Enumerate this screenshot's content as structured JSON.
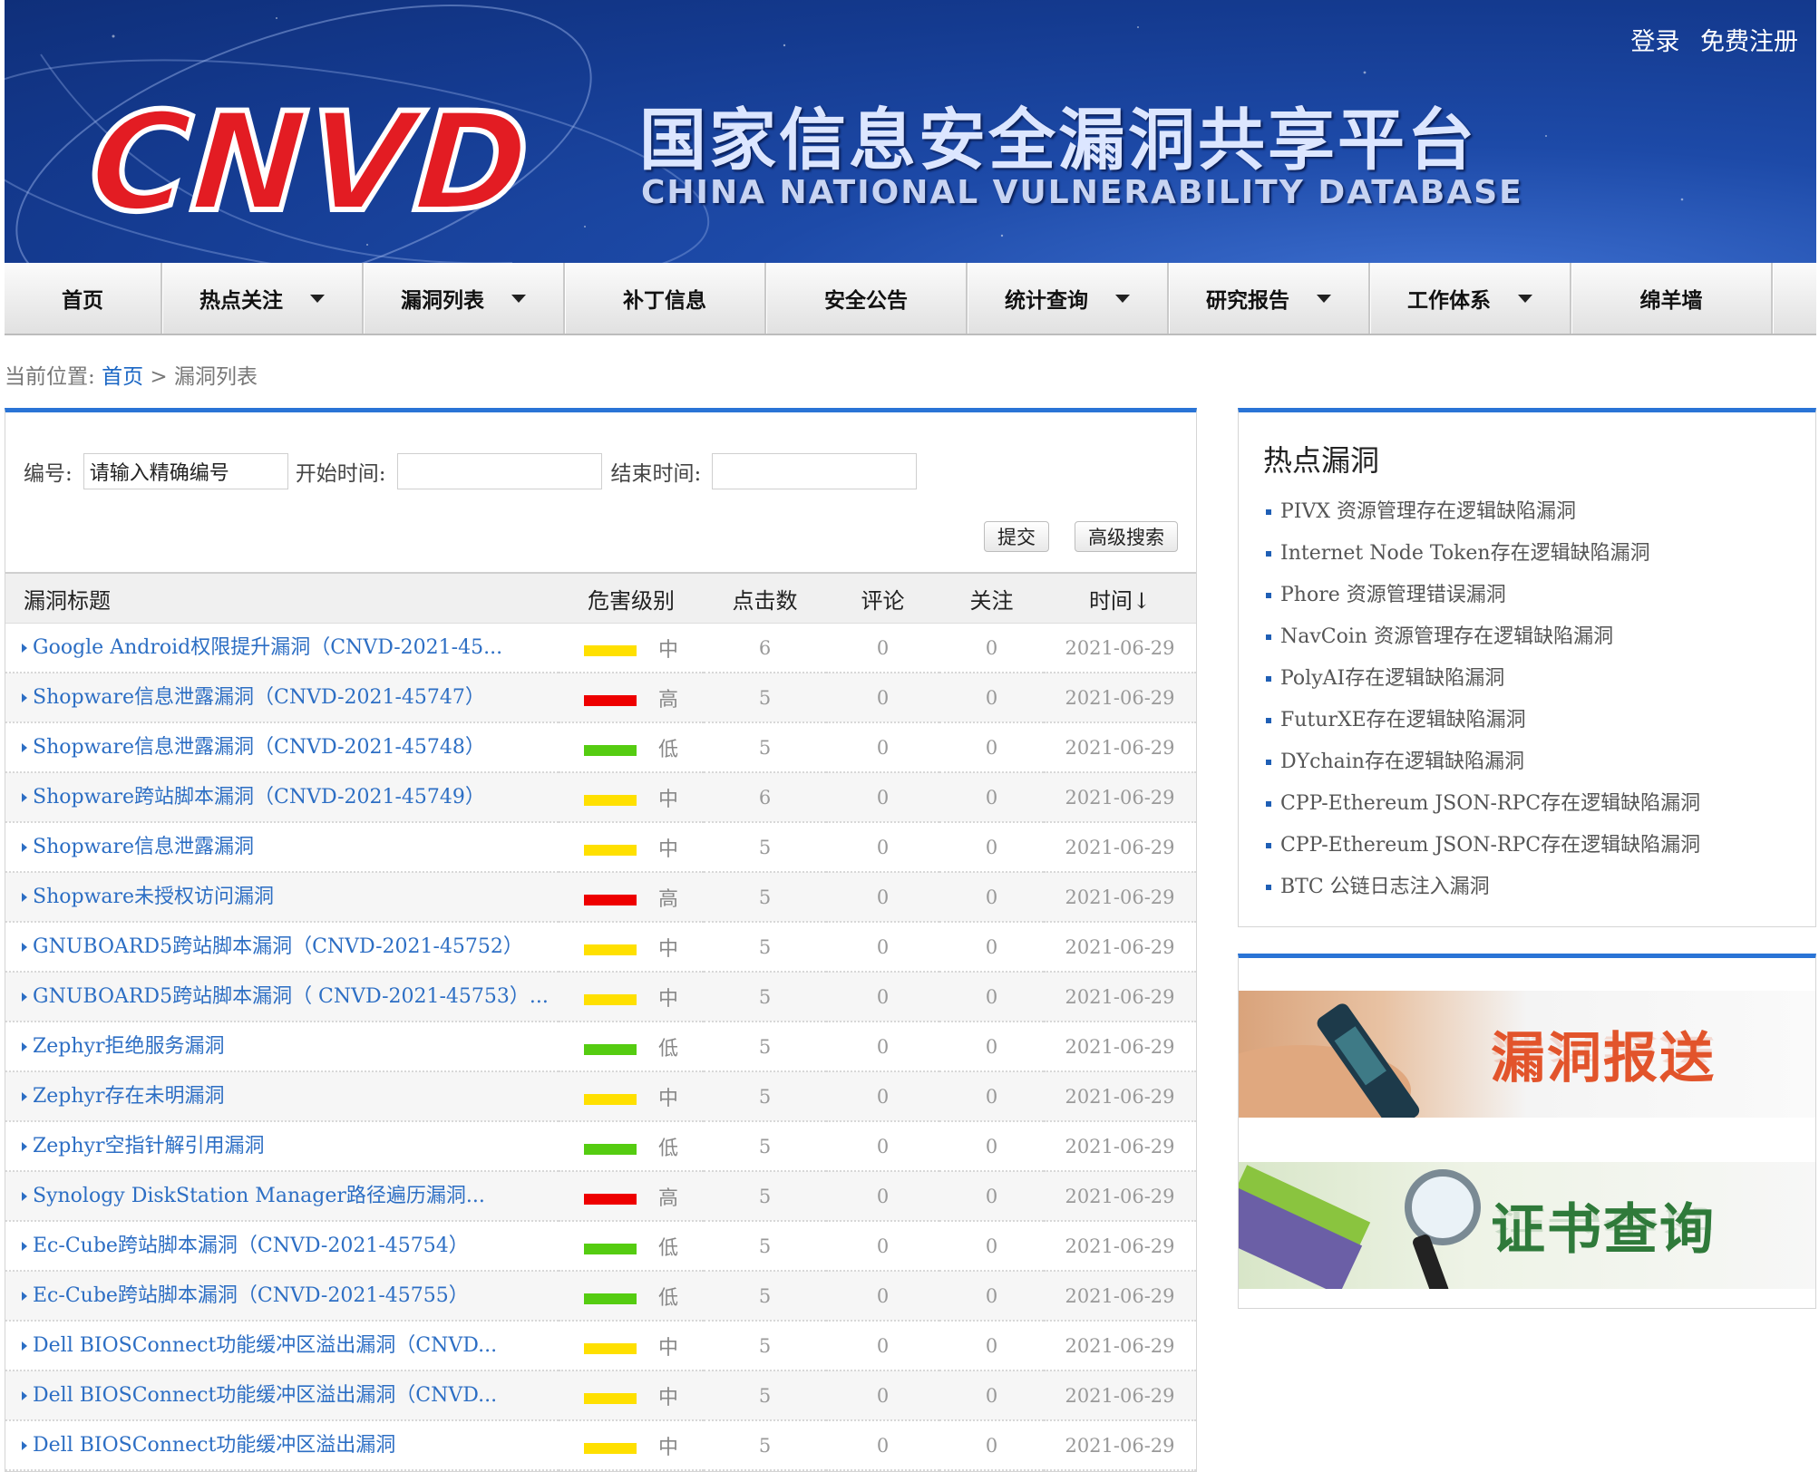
{
  "header": {
    "logo_text": "CNVD",
    "title": "国家信息安全漏洞共享平台",
    "subtitle": "CHINA NATIONAL VULNERABILITY DATABASE",
    "login": "登录",
    "register": "免费注册"
  },
  "nav": [
    {
      "label": "首页",
      "dropdown": false
    },
    {
      "label": "热点关注",
      "dropdown": true
    },
    {
      "label": "漏洞列表",
      "dropdown": true
    },
    {
      "label": "补丁信息",
      "dropdown": false
    },
    {
      "label": "安全公告",
      "dropdown": false
    },
    {
      "label": "统计查询",
      "dropdown": true
    },
    {
      "label": "研究报告",
      "dropdown": true
    },
    {
      "label": "工作体系",
      "dropdown": true
    },
    {
      "label": "绵羊墙",
      "dropdown": false
    }
  ],
  "breadcrumb": {
    "prefix": "当前位置:",
    "home": "首页",
    "sep": ">",
    "current": "漏洞列表"
  },
  "search": {
    "id_label": "编号:",
    "id_value": "请输入精确编号",
    "start_label": "开始时间:",
    "end_label": "结束时间:",
    "submit": "提交",
    "advanced": "高级搜索"
  },
  "colors": {
    "high": "#ee0000",
    "medium": "#ffe000",
    "low": "#55cc11",
    "accent": "#2a74d6",
    "link": "#2c6ec4"
  },
  "table": {
    "headers": {
      "title": "漏洞标题",
      "severity": "危害级别",
      "clicks": "点击数",
      "comments": "评论",
      "follows": "关注",
      "time": "时间↓"
    },
    "rows": [
      {
        "title": "Google Android权限提升漏洞（CNVD-2021-45...",
        "level": "medium",
        "severity": "中",
        "clicks": "6",
        "comments": "0",
        "follows": "0",
        "time": "2021-06-29"
      },
      {
        "title": "Shopware信息泄露漏洞（CNVD-2021-45747）",
        "level": "high",
        "severity": "高",
        "clicks": "5",
        "comments": "0",
        "follows": "0",
        "time": "2021-06-29"
      },
      {
        "title": "Shopware信息泄露漏洞（CNVD-2021-45748）",
        "level": "low",
        "severity": "低",
        "clicks": "5",
        "comments": "0",
        "follows": "0",
        "time": "2021-06-29"
      },
      {
        "title": "Shopware跨站脚本漏洞（CNVD-2021-45749）",
        "level": "medium",
        "severity": "中",
        "clicks": "6",
        "comments": "0",
        "follows": "0",
        "time": "2021-06-29"
      },
      {
        "title": "Shopware信息泄露漏洞",
        "level": "medium",
        "severity": "中",
        "clicks": "5",
        "comments": "0",
        "follows": "0",
        "time": "2021-06-29"
      },
      {
        "title": "Shopware未授权访问漏洞",
        "level": "high",
        "severity": "高",
        "clicks": "5",
        "comments": "0",
        "follows": "0",
        "time": "2021-06-29"
      },
      {
        "title": "GNUBOARD5跨站脚本漏洞（CNVD-2021-45752）",
        "level": "medium",
        "severity": "中",
        "clicks": "5",
        "comments": "0",
        "follows": "0",
        "time": "2021-06-29"
      },
      {
        "title": "GNUBOARD5跨站脚本漏洞（ CNVD-2021-45753）...",
        "level": "medium",
        "severity": "中",
        "clicks": "5",
        "comments": "0",
        "follows": "0",
        "time": "2021-06-29"
      },
      {
        "title": "Zephyr拒绝服务漏洞",
        "level": "low",
        "severity": "低",
        "clicks": "5",
        "comments": "0",
        "follows": "0",
        "time": "2021-06-29"
      },
      {
        "title": "Zephyr存在未明漏洞",
        "level": "medium",
        "severity": "中",
        "clicks": "5",
        "comments": "0",
        "follows": "0",
        "time": "2021-06-29"
      },
      {
        "title": "Zephyr空指针解引用漏洞",
        "level": "low",
        "severity": "低",
        "clicks": "5",
        "comments": "0",
        "follows": "0",
        "time": "2021-06-29"
      },
      {
        "title": "Synology DiskStation Manager路径遍历漏洞...",
        "level": "high",
        "severity": "高",
        "clicks": "5",
        "comments": "0",
        "follows": "0",
        "time": "2021-06-29"
      },
      {
        "title": "Ec-Cube跨站脚本漏洞（CNVD-2021-45754）",
        "level": "low",
        "severity": "低",
        "clicks": "5",
        "comments": "0",
        "follows": "0",
        "time": "2021-06-29"
      },
      {
        "title": "Ec-Cube跨站脚本漏洞（CNVD-2021-45755）",
        "level": "low",
        "severity": "低",
        "clicks": "5",
        "comments": "0",
        "follows": "0",
        "time": "2021-06-29"
      },
      {
        "title": "Dell BIOSConnect功能缓冲区溢出漏洞（CNVD...",
        "level": "medium",
        "severity": "中",
        "clicks": "5",
        "comments": "0",
        "follows": "0",
        "time": "2021-06-29"
      },
      {
        "title": "Dell BIOSConnect功能缓冲区溢出漏洞（CNVD...",
        "level": "medium",
        "severity": "中",
        "clicks": "5",
        "comments": "0",
        "follows": "0",
        "time": "2021-06-29"
      },
      {
        "title": "Dell BIOSConnect功能缓冲区溢出漏洞",
        "level": "medium",
        "severity": "中",
        "clicks": "5",
        "comments": "0",
        "follows": "0",
        "time": "2021-06-29"
      }
    ]
  },
  "hot": {
    "title": "热点漏洞",
    "items": [
      "PIVX 资源管理存在逻辑缺陷漏洞",
      "Internet Node Token存在逻辑缺陷漏洞",
      "Phore 资源管理错误漏洞",
      "NavCoin 资源管理存在逻辑缺陷漏洞",
      "PolyAI存在逻辑缺陷漏洞",
      "FuturXE存在逻辑缺陷漏洞",
      "DYchain存在逻辑缺陷漏洞",
      "CPP-Ethereum JSON-RPC存在逻辑缺陷漏洞",
      "CPP-Ethereum JSON-RPC存在逻辑缺陷漏洞",
      "BTC 公链日志注入漏洞"
    ]
  },
  "promos": {
    "report": "漏洞报送",
    "cert": "证书查询"
  }
}
